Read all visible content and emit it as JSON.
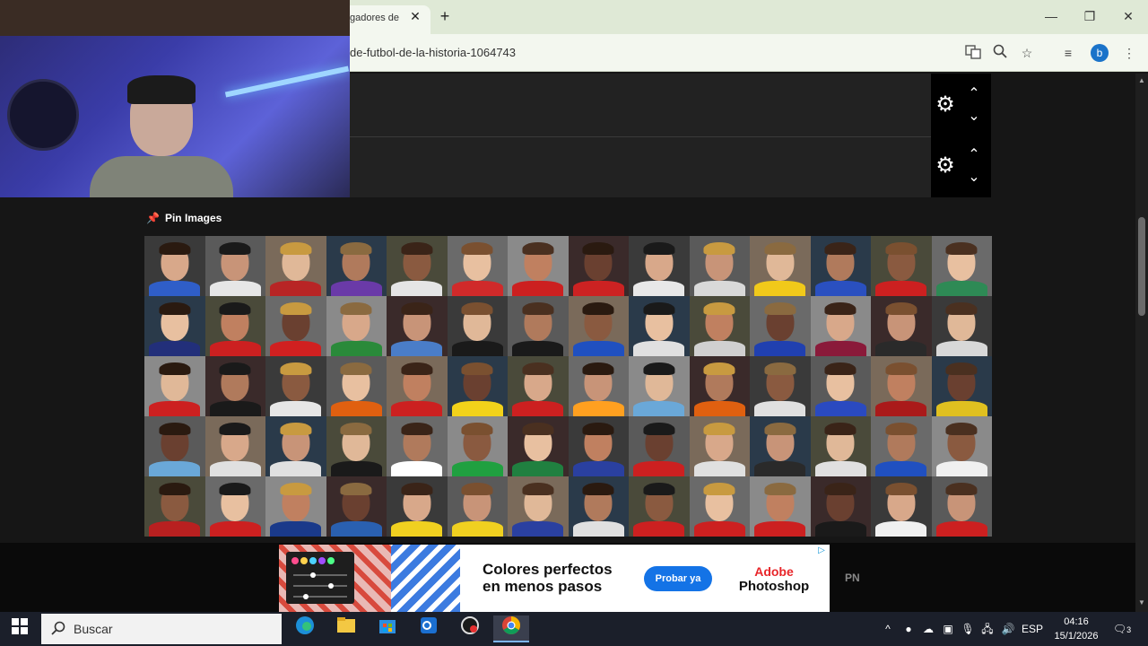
{
  "browser": {
    "tab_title": "gadores de",
    "tab_close": "✕",
    "new_tab": "+",
    "url": "de-futbol-de-la-historia-1064743",
    "profile_initial": "b",
    "window_controls": {
      "minimize": "—",
      "restore": "❐",
      "close": "✕"
    },
    "toolbar_icons": [
      "translate-icon",
      "zoom-icon",
      "bookmark-star-icon",
      "media-control-icon",
      "menu-kebab-icon"
    ]
  },
  "page": {
    "pin_section_title": "Pin Images",
    "control_rows": [
      {
        "settings_icon": "⚙",
        "up": "⌃",
        "down": "⌄"
      },
      {
        "settings_icon": "⚙",
        "up": "⌃",
        "down": "⌄"
      }
    ],
    "portrait_grid": {
      "rows": 5,
      "columns": 14,
      "palette": [
        [
          "#2f5ec8",
          "#e6e6e6",
          "#b82525",
          "#6a3aa8",
          "#e5e5e5",
          "#d02a2a",
          "#cc2020",
          "#cc2222",
          "#e8e8e8",
          "#d9d9d9",
          "#f1c91a",
          "#2a50c0",
          "#cc2020",
          "#2e8a55"
        ],
        [
          "#222f7a",
          "#cc2020",
          "#d02020",
          "#2a8a3a",
          "#4a7dc8",
          "#1a1a1a",
          "#1a1a1a",
          "#2050c0",
          "#e0e0e0",
          "#d0d0d0",
          "#2040b0",
          "#8a1a3a",
          "#2a2a2a",
          "#d8d8d8"
        ],
        [
          "#cc2020",
          "#1a1a1a",
          "#e6e6e6",
          "#e06010",
          "#cc2020",
          "#f2d21a",
          "#cc2020",
          "#ffa020",
          "#6aa8d8",
          "#e06010",
          "#e0e0e0",
          "#2a4ac0",
          "#aa1a1a",
          "#e0c020"
        ],
        [
          "#6aa8d8",
          "#e0e0e0",
          "#e0e0e0",
          "#1a1a1a",
          "#ffffff",
          "#20a040",
          "#208040",
          "#2a40a0",
          "#cc2020",
          "#e0e0e0",
          "#2a2a2a",
          "#e0e0e0",
          "#2050c0",
          "#f0f0f0"
        ],
        [
          "#b82020",
          "#cc2020",
          "#1a3a8a",
          "#2a60b0",
          "#f0d020",
          "#f0d020",
          "#2a40a0",
          "#e0e0e0",
          "#cc2020",
          "#cc2020",
          "#cc2020",
          "#1a1a1a",
          "#f0f0f0",
          "#cc2020"
        ]
      ],
      "skin_tones": [
        "#d8a88a",
        "#c89478",
        "#e0b898",
        "#b07a5c",
        "#8a5a40",
        "#e8c0a0",
        "#c08060",
        "#6a4030"
      ],
      "hair_tones": [
        "#2a1a10",
        "#3a2418",
        "#1a1a1a",
        "#7a5030",
        "#c89a40",
        "#4a3020",
        "#8a6a40"
      ]
    }
  },
  "ad": {
    "headline_line1": "Colores perfectos",
    "headline_line2": "en menos pasos",
    "cta": "Probar ya",
    "brand_line1": "Adobe",
    "brand_line2": "Photoshop",
    "adchoices": "▷",
    "side_tag": "PN"
  },
  "taskbar": {
    "search_placeholder": "Buscar",
    "apps": [
      "edge-icon",
      "file-explorer-icon",
      "store-icon",
      "outlook-icon",
      "screen-recorder-icon",
      "chrome-icon"
    ],
    "language": "ESP",
    "time": "04:16",
    "date": "15/1/2026",
    "notifications": "3"
  }
}
